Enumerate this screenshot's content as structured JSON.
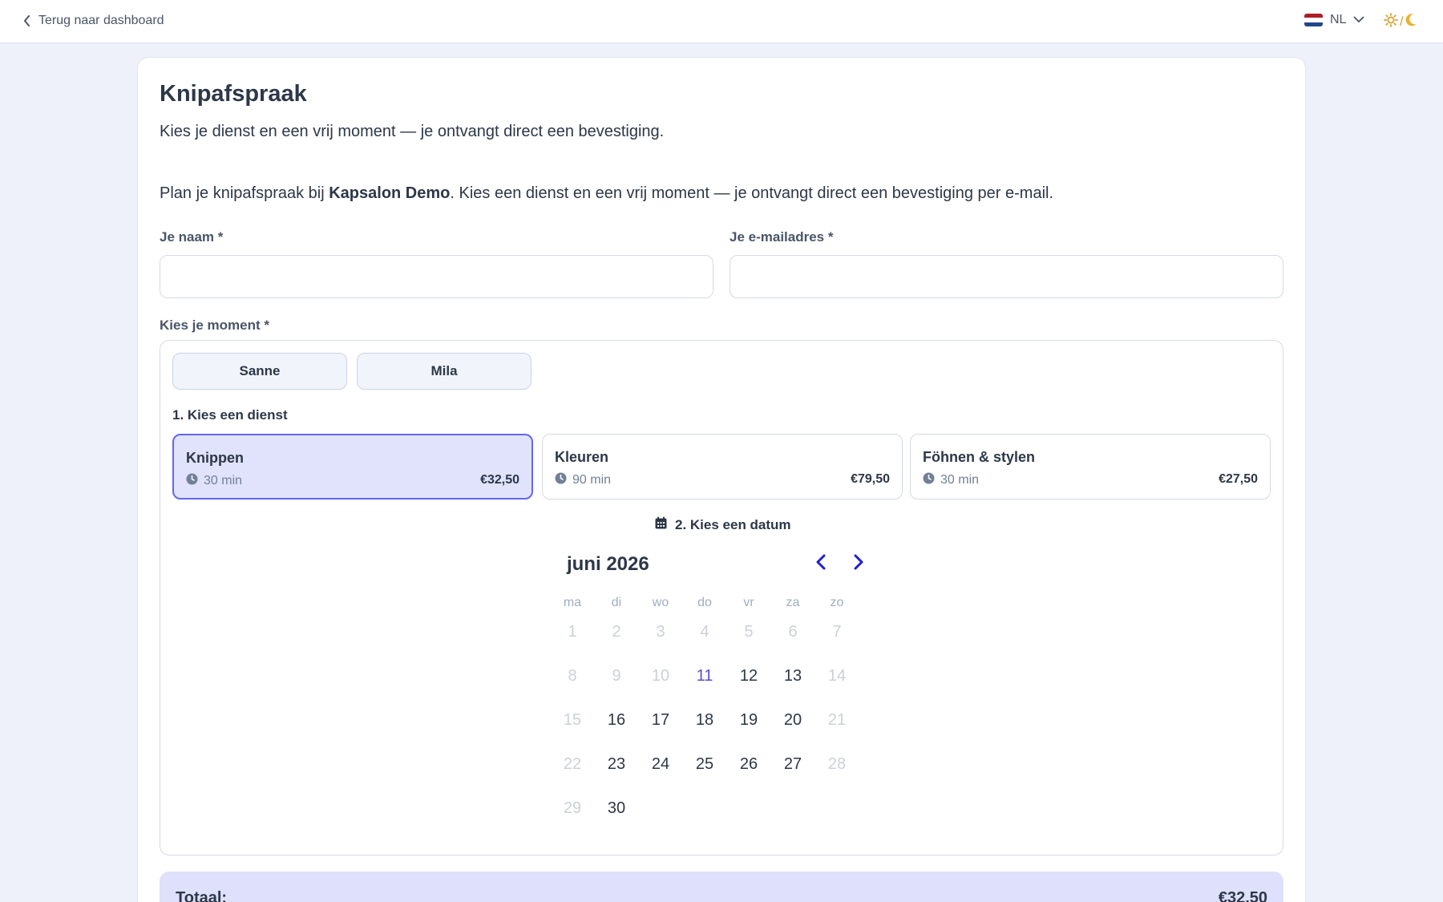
{
  "topbar": {
    "back_label": "Terug naar dashboard",
    "language": "NL",
    "theme_separator": "/"
  },
  "page": {
    "title": "Knipafspraak",
    "subtitle": "Kies je dienst en een vrij moment — je ontvangt direct een bevestiging.",
    "intro_before": "Plan je knipafspraak bij ",
    "intro_bold": "Kapsalon Demo",
    "intro_after": ". Kies een dienst en een vrij moment — je ontvangt direct een bevestiging per e-mail."
  },
  "form": {
    "name_label": "Je naam *",
    "name_value": "",
    "email_label": "Je e-mailadres *",
    "email_value": "",
    "moment_label": "Kies je moment *"
  },
  "staff": [
    "Sanne",
    "Mila"
  ],
  "services": {
    "step_label": "1. Kies een dienst",
    "items": [
      {
        "name": "Knippen",
        "duration": "30 min",
        "price": "€32,50",
        "selected": true
      },
      {
        "name": "Kleuren",
        "duration": "90 min",
        "price": "€79,50",
        "selected": false
      },
      {
        "name": "Föhnen & stylen",
        "duration": "30 min",
        "price": "€27,50",
        "selected": false
      }
    ]
  },
  "calendar": {
    "step_label": "2. Kies een datum",
    "month": "juni 2026",
    "weekdays": [
      "ma",
      "di",
      "wo",
      "do",
      "vr",
      "za",
      "zo"
    ],
    "weeks": [
      [
        "1",
        "2",
        "3",
        "4",
        "5",
        "6",
        "7"
      ],
      [
        "8",
        "9",
        "10",
        "11",
        "12",
        "13",
        "14"
      ],
      [
        "15",
        "16",
        "17",
        "18",
        "19",
        "20",
        "21"
      ],
      [
        "22",
        "23",
        "24",
        "25",
        "26",
        "27",
        "28"
      ],
      [
        "29",
        "30"
      ]
    ],
    "disabled_days": [
      "1",
      "2",
      "3",
      "4",
      "5",
      "6",
      "7",
      "8",
      "9",
      "10",
      "14",
      "15",
      "21",
      "22",
      "28",
      "29"
    ],
    "today": "11"
  },
  "total": {
    "label": "Totaal:",
    "value": "€32,50"
  },
  "colors": {
    "accent": "#6366f1",
    "nav_arrow": "#1d1ddb",
    "today": "#5a4fcf",
    "selected_bg": "#e0e3fb",
    "total_bg": "#dfe0fb",
    "theme_icon": "#d69e2e"
  },
  "icons": {
    "back": "chevron-left-icon",
    "language_flag": "netherlands-flag-icon",
    "language_caret": "chevron-down-icon",
    "theme_light": "sun-icon",
    "theme_dark": "moon-icon",
    "duration": "clock-icon",
    "calendar": "calendar-icon",
    "prev": "chevron-left-icon",
    "next": "chevron-right-icon"
  }
}
